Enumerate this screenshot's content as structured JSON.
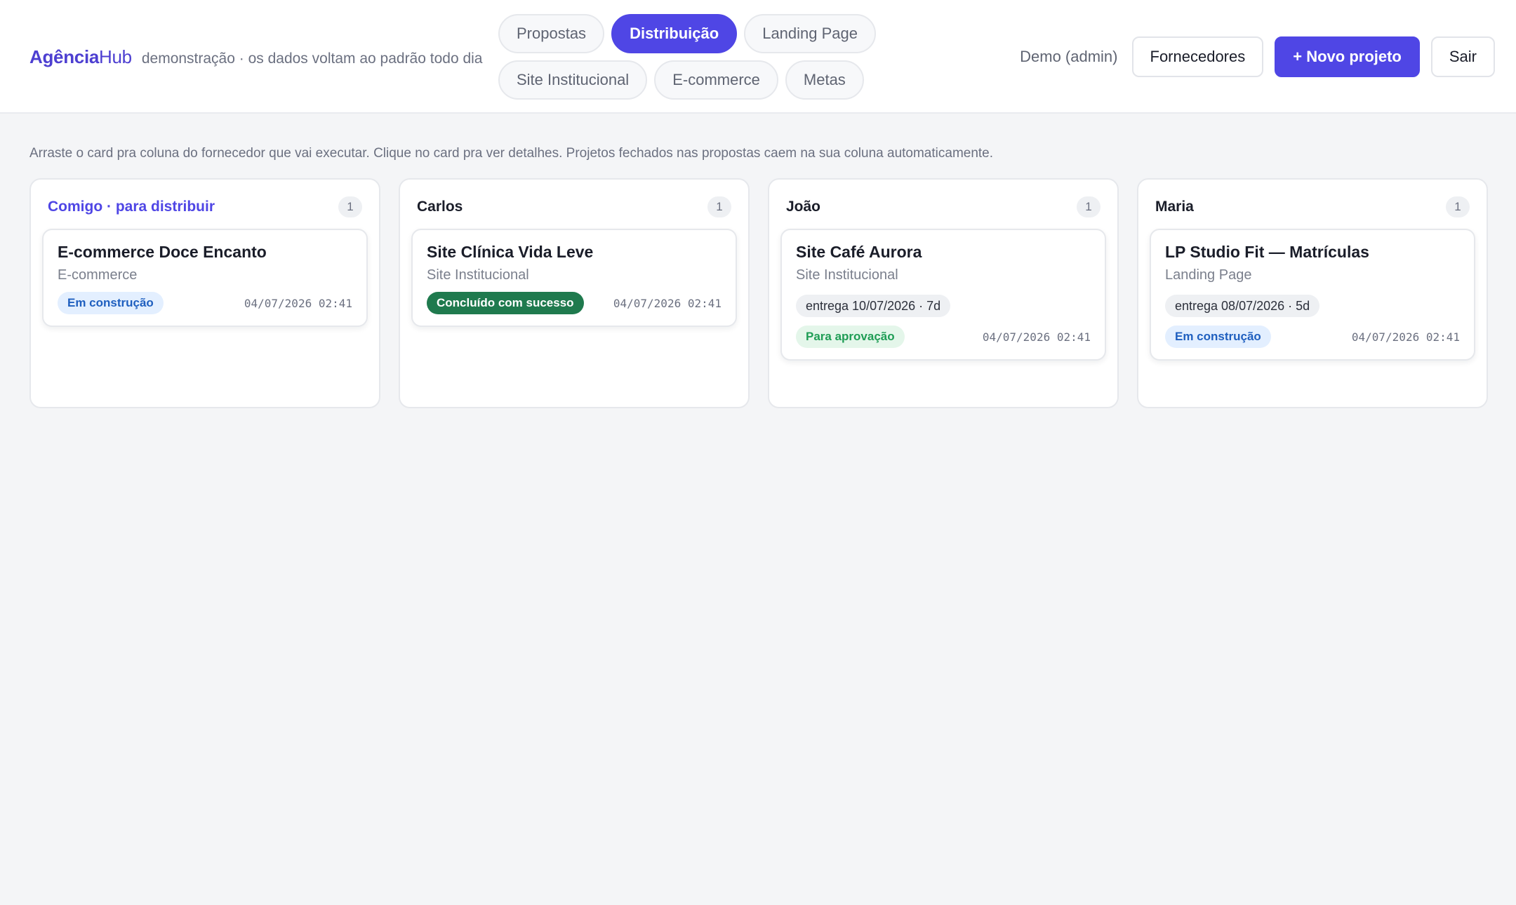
{
  "header": {
    "brand_bold": "Agência",
    "brand_light": "Hub",
    "subtitle": "demonstração · os dados voltam ao padrão todo dia",
    "tabs_row1": [
      "Propostas",
      "Distribuição",
      "Landing Page"
    ],
    "tabs_row2": [
      "Site Institucional",
      "E-commerce",
      "Metas"
    ],
    "active_tab": "Distribuição",
    "user_label": "Demo (admin)",
    "suppliers_button": "Fornecedores",
    "new_project_button": "+ Novo projeto",
    "logout_button": "Sair"
  },
  "main": {
    "hint": "Arraste o card pra coluna do fornecedor que vai executar. Clique no card pra ver detalhes. Projetos fechados nas propostas caem na sua coluna automaticamente."
  },
  "columns": [
    {
      "title": "Comigo · para distribuir",
      "count": "1",
      "card": {
        "title": "E-commerce Doce Encanto",
        "type": "E-commerce",
        "status": "Em construção",
        "timestamp": "04/07/2026 02:41"
      }
    },
    {
      "title": "Carlos",
      "count": "1",
      "card": {
        "title": "Site Clínica Vida Leve",
        "type": "Site Institucional",
        "status": "Concluído com sucesso",
        "timestamp": "04/07/2026 02:41"
      }
    },
    {
      "title": "João",
      "count": "1",
      "card": {
        "title": "Site Café Aurora",
        "type": "Site Institucional",
        "due": "entrega 10/07/2026 · 7d",
        "status": "Para aprovação",
        "timestamp": "04/07/2026 02:41"
      }
    },
    {
      "title": "Maria",
      "count": "1",
      "card": {
        "title": "LP Studio Fit — Matrículas",
        "type": "Landing Page",
        "due": "entrega 08/07/2026 · 5d",
        "status": "Em construção",
        "timestamp": "04/07/2026 02:41"
      }
    }
  ],
  "colors": {
    "accent": "#4f46e5",
    "status_building_bg": "#e3efff",
    "status_building_text": "#1f5fbf",
    "status_done_bg": "#1f7a4e",
    "status_approval_bg": "#e4f6ea",
    "status_approval_text": "#1f9d55"
  }
}
